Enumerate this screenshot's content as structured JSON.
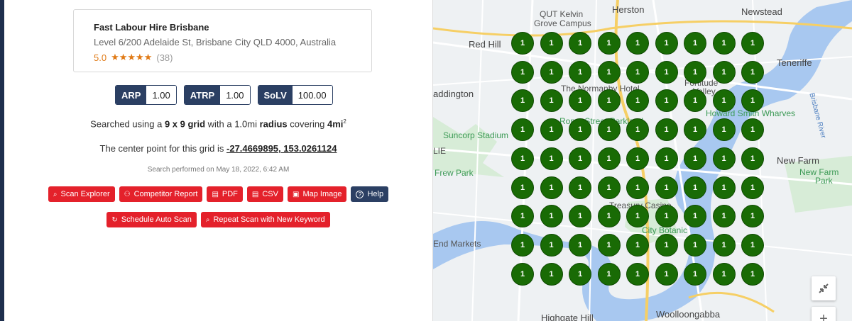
{
  "business": {
    "name": "Fast Labour Hire Brisbane",
    "address": "Level 6/200 Adelaide St, Brisbane City QLD 4000, Australia",
    "rating": "5.0",
    "stars": 5,
    "reviews": "(38)"
  },
  "metrics": [
    {
      "label": "ARP",
      "value": "1.00"
    },
    {
      "label": "ATRP",
      "value": "1.00"
    },
    {
      "label": "SoLV",
      "value": "100.00"
    }
  ],
  "grid_info": {
    "prefix": "Searched using a ",
    "grid": "9 x 9 grid",
    "middle": " with a 1.0mi ",
    "radius": "radius",
    "covering": " covering ",
    "area": "4mi",
    "area_sup": "2"
  },
  "center_info": {
    "prefix": "The center point for this grid is ",
    "coords": "-27.4669895, 153.0261124"
  },
  "performed": "Search performed on May 18, 2022, 6:42 AM",
  "buttons_row1": [
    {
      "label": "Scan Explorer",
      "icon": "search-icon",
      "style": "red"
    },
    {
      "label": "Competitor Report",
      "icon": "users-icon",
      "style": "red"
    },
    {
      "label": "PDF",
      "icon": "file-icon",
      "style": "red"
    },
    {
      "label": "CSV",
      "icon": "file-icon",
      "style": "red"
    },
    {
      "label": "Map Image",
      "icon": "image-file-icon",
      "style": "red"
    },
    {
      "label": "Help",
      "icon": "question-circle-icon",
      "style": "navy"
    }
  ],
  "buttons_row2": [
    {
      "label": "Schedule Auto Scan",
      "icon": "refresh-icon",
      "style": "red"
    },
    {
      "label": "Repeat Scan with New Keyword",
      "icon": "search-icon",
      "style": "red"
    }
  ],
  "map": {
    "labels": [
      {
        "text": "Herston"
      },
      {
        "text": "QUT Kelvin"
      },
      {
        "text": "Grove Campus"
      },
      {
        "text": "Newstead"
      },
      {
        "text": "Red Hill"
      },
      {
        "text": "Teneriffe"
      },
      {
        "text": "addington"
      },
      {
        "text": "The Normanby Hotel"
      },
      {
        "text": "Fortitude"
      },
      {
        "text": "Valley"
      },
      {
        "text": "Howard Smith Wharves"
      },
      {
        "text": "Suncorp Stadium"
      },
      {
        "text": "Roma Street Parkland"
      },
      {
        "text": "New Farm"
      },
      {
        "text": "LIE"
      },
      {
        "text": "Frew Park"
      },
      {
        "text": "New Farm"
      },
      {
        "text": "Park"
      },
      {
        "text": "Treasury Casino"
      },
      {
        "text": "City Botanic"
      },
      {
        "text": "End Markets"
      },
      {
        "text": "Highgate Hill"
      },
      {
        "text": "Woolloongabba"
      },
      {
        "text": "Brisbane River"
      }
    ],
    "grid_rows": 9,
    "grid_cols": 9,
    "rank_values": [
      [
        "1",
        "1",
        "1",
        "1",
        "1",
        "1",
        "1",
        "1",
        "1"
      ],
      [
        "1",
        "1",
        "1",
        "1",
        "1",
        "1",
        "1",
        "1",
        "1"
      ],
      [
        "1",
        "1",
        "1",
        "1",
        "1",
        "1",
        "1",
        "1",
        "1"
      ],
      [
        "1",
        "1",
        "1",
        "1",
        "1",
        "1",
        "1",
        "1",
        "1"
      ],
      [
        "1",
        "1",
        "1",
        "1",
        "1",
        "1",
        "1",
        "1",
        "1"
      ],
      [
        "1",
        "1",
        "1",
        "1",
        "1",
        "1",
        "1",
        "1",
        "1"
      ],
      [
        "1",
        "1",
        "1",
        "1",
        "1",
        "1",
        "1",
        "1",
        "1"
      ],
      [
        "1",
        "1",
        "1",
        "1",
        "1",
        "1",
        "1",
        "1",
        "1"
      ],
      [
        "1",
        "1",
        "1",
        "1",
        "1",
        "1",
        "1",
        "1",
        "1"
      ]
    ],
    "controls": {
      "zoom_in": "+",
      "fullscreen_icon": "collapse-icon"
    }
  },
  "colors": {
    "marker": "#196b05",
    "accent_red": "#e4212b",
    "navy": "#2b3f63",
    "star": "#e07a16"
  }
}
